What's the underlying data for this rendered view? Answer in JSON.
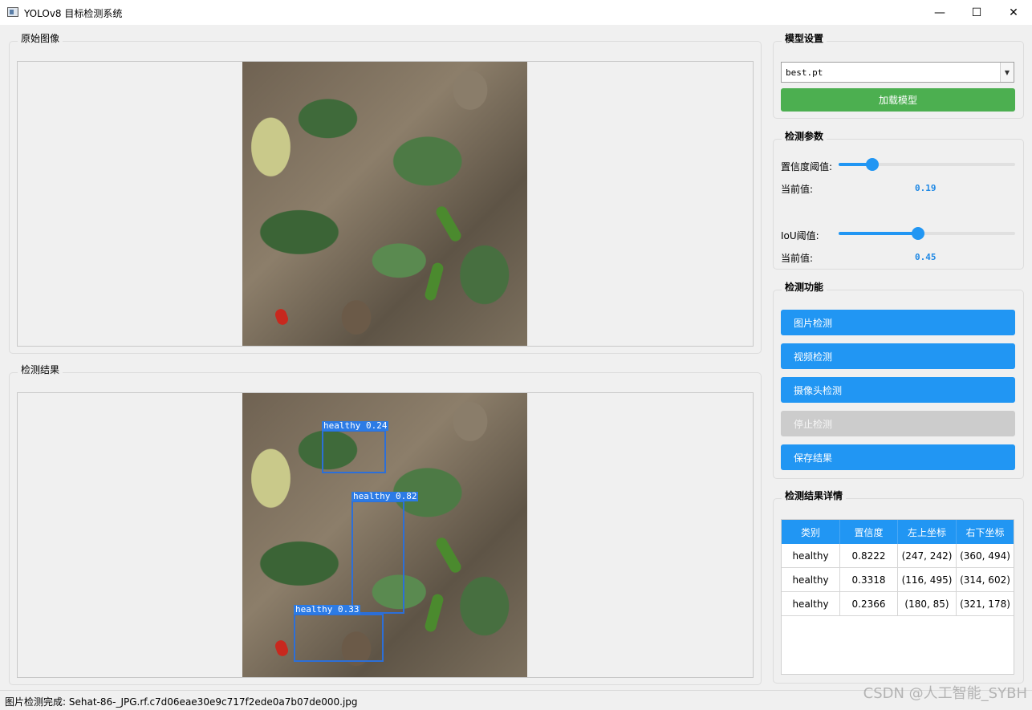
{
  "window": {
    "title": "YOLOv8 目标检测系统",
    "minimize": "—",
    "maximize": "☐",
    "close": "✕"
  },
  "original": {
    "title": "原始图像"
  },
  "result": {
    "title": "检测结果",
    "detections": [
      {
        "label": "healthy  0.24"
      },
      {
        "label": "healthy  0.82"
      },
      {
        "label": "healthy  0.33"
      }
    ]
  },
  "model": {
    "title": "模型设置",
    "selected": "best.pt",
    "load_button": "加载模型"
  },
  "params": {
    "title": "检测参数",
    "confidence": {
      "label": "置信度阈值:",
      "current_label": "当前值:",
      "value": "0.19",
      "fraction": 0.19
    },
    "iou": {
      "label": "IoU阈值:",
      "current_label": "当前值:",
      "value": "0.45",
      "fraction": 0.45
    }
  },
  "functions": {
    "title": "检测功能",
    "image": "图片检测",
    "video": "视频检测",
    "camera": "摄像头检测",
    "stop": "停止检测",
    "save": "保存结果"
  },
  "details": {
    "title": "检测结果详情",
    "headers": [
      "类别",
      "置信度",
      "左上坐标",
      "右下坐标"
    ],
    "rows": [
      [
        "healthy",
        "0.8222",
        "(247, 242)",
        "(360, 494)"
      ],
      [
        "healthy",
        "0.3318",
        "(116, 495)",
        "(314, 602)"
      ],
      [
        "healthy",
        "0.2366",
        "(180, 85)",
        "(321, 178)"
      ]
    ]
  },
  "status": {
    "text": "图片检测完成: Sehat-86-_JPG.rf.c7d06eae30e9c717f2ede0a7b07de000.jpg"
  },
  "watermark": "CSDN @人工智能_SYBH",
  "colors": {
    "accent": "#2196f3",
    "load": "#4caf50",
    "disabled": "#cccccc",
    "box": "#2c6fd8"
  }
}
